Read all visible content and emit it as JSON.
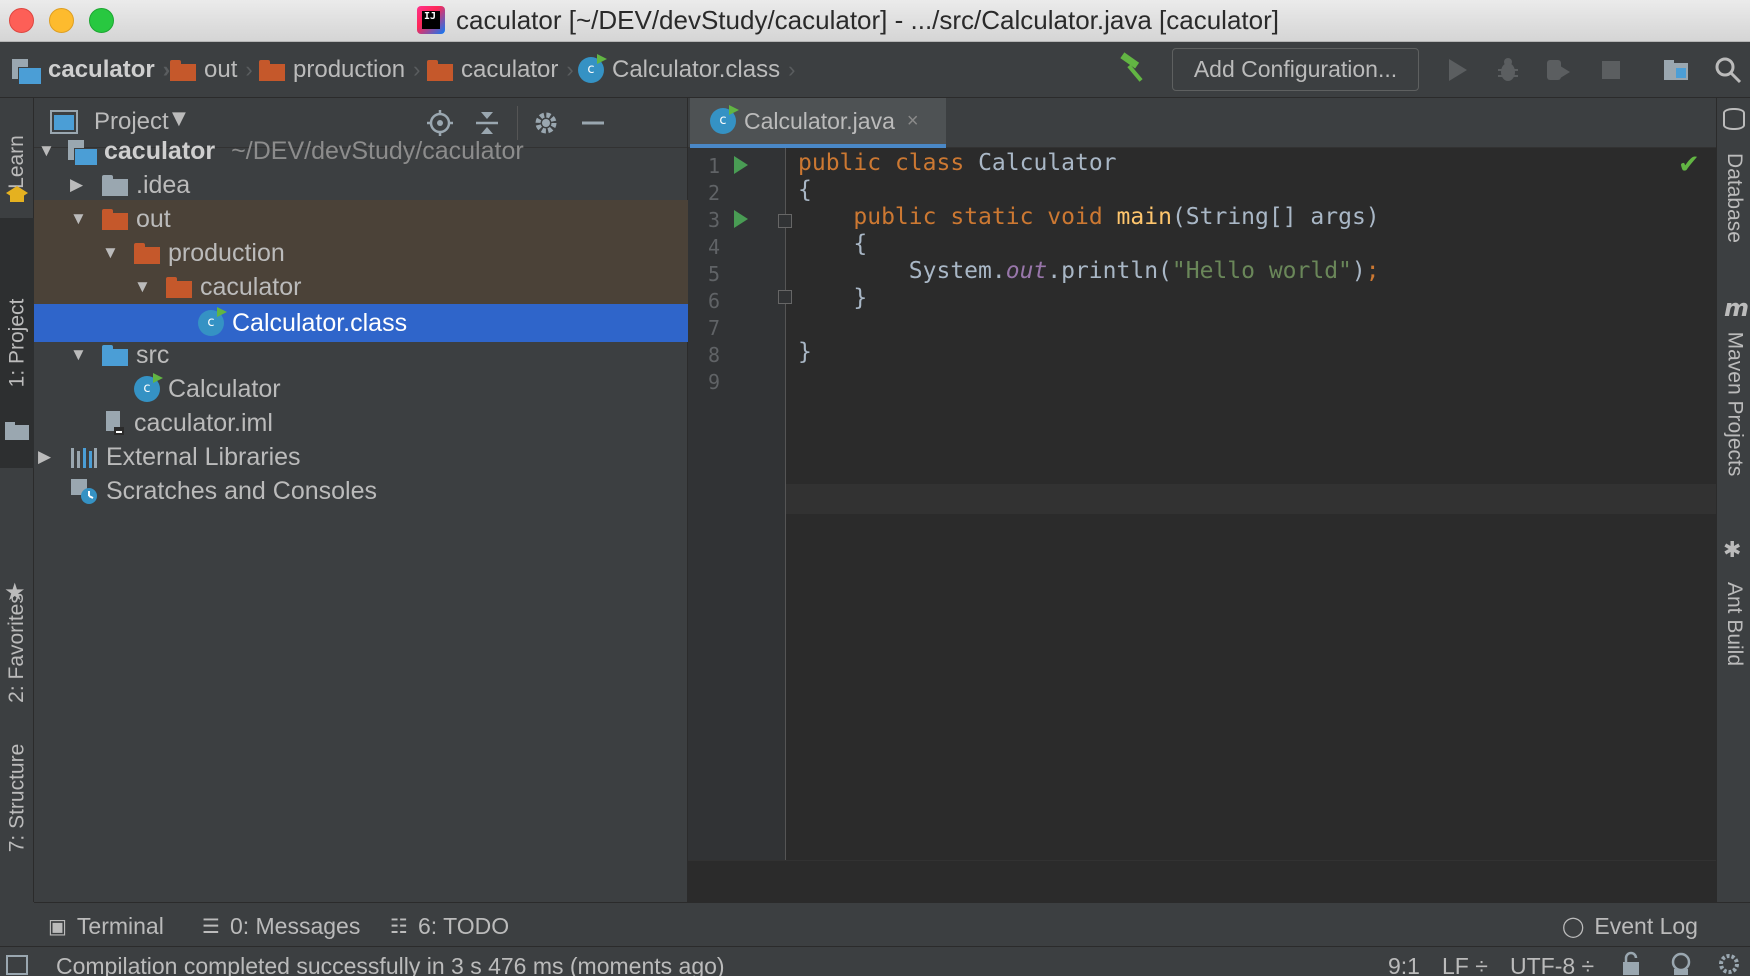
{
  "window": {
    "title": "caculator [~/DEV/devStudy/caculator] - .../src/Calculator.java [caculator]",
    "app_icon_text": "IJ"
  },
  "breadcrumb": [
    {
      "label": "caculator",
      "icon": "project-icon"
    },
    {
      "label": "out",
      "icon": "folder-icon"
    },
    {
      "label": "production",
      "icon": "folder-icon"
    },
    {
      "label": "caculator",
      "icon": "folder-icon"
    },
    {
      "label": "Calculator.class",
      "icon": "class-icon"
    }
  ],
  "toolbar": {
    "add_configuration": "Add Configuration..."
  },
  "left_tabs": {
    "learn": "Learn",
    "project": "1: Project",
    "favorites": "2: Favorites",
    "structure": "7: Structure"
  },
  "right_tabs": {
    "database": "Database",
    "maven": "Maven Projects",
    "ant": "Ant Build"
  },
  "project_panel": {
    "title": "Project",
    "tree": [
      {
        "label": "caculator",
        "suffix": "~/DEV/devStudy/caculator"
      },
      {
        "label": ".idea"
      },
      {
        "label": "out"
      },
      {
        "label": "production"
      },
      {
        "label": "caculator"
      },
      {
        "label": "Calculator.class"
      },
      {
        "label": "src"
      },
      {
        "label": "Calculator"
      },
      {
        "label": "caculator.iml"
      },
      {
        "label": "External Libraries"
      },
      {
        "label": "Scratches and Consoles"
      }
    ]
  },
  "editor": {
    "tab_label": "Calculator.java",
    "tab_close": "×",
    "line_numbers": [
      "1",
      "2",
      "3",
      "4",
      "5",
      "6",
      "7",
      "8",
      "9"
    ],
    "code": {
      "l1_kw1": "public",
      "l1_kw2": "class",
      "l1_name": "Calculator",
      "l2": "{",
      "l3_kw1": "public",
      "l3_kw2": "static",
      "l3_kw3": "void",
      "l3_fn": "main",
      "l3_params": "(String[] args)",
      "l4": "{",
      "l5_obj": "System.",
      "l5_field": "out",
      "l5_call": ".println(",
      "l5_str": "\"Hello world\"",
      "l5_end_paren": ")",
      "l5_semi": ";",
      "l6": "}",
      "l8": "}"
    }
  },
  "bottom_tools": {
    "terminal": "Terminal",
    "messages": "0: Messages",
    "todo": "6: TODO",
    "event_log": "Event Log"
  },
  "status": {
    "message": "Compilation completed successfully in 3 s 476 ms (moments ago)",
    "position": "9:1",
    "line_sep": "LF ÷",
    "encoding": "UTF-8 ÷"
  },
  "colors": {
    "selection": "#2f65ca",
    "keyword": "#cc7832",
    "string": "#6a8759",
    "function": "#ffc66d"
  }
}
